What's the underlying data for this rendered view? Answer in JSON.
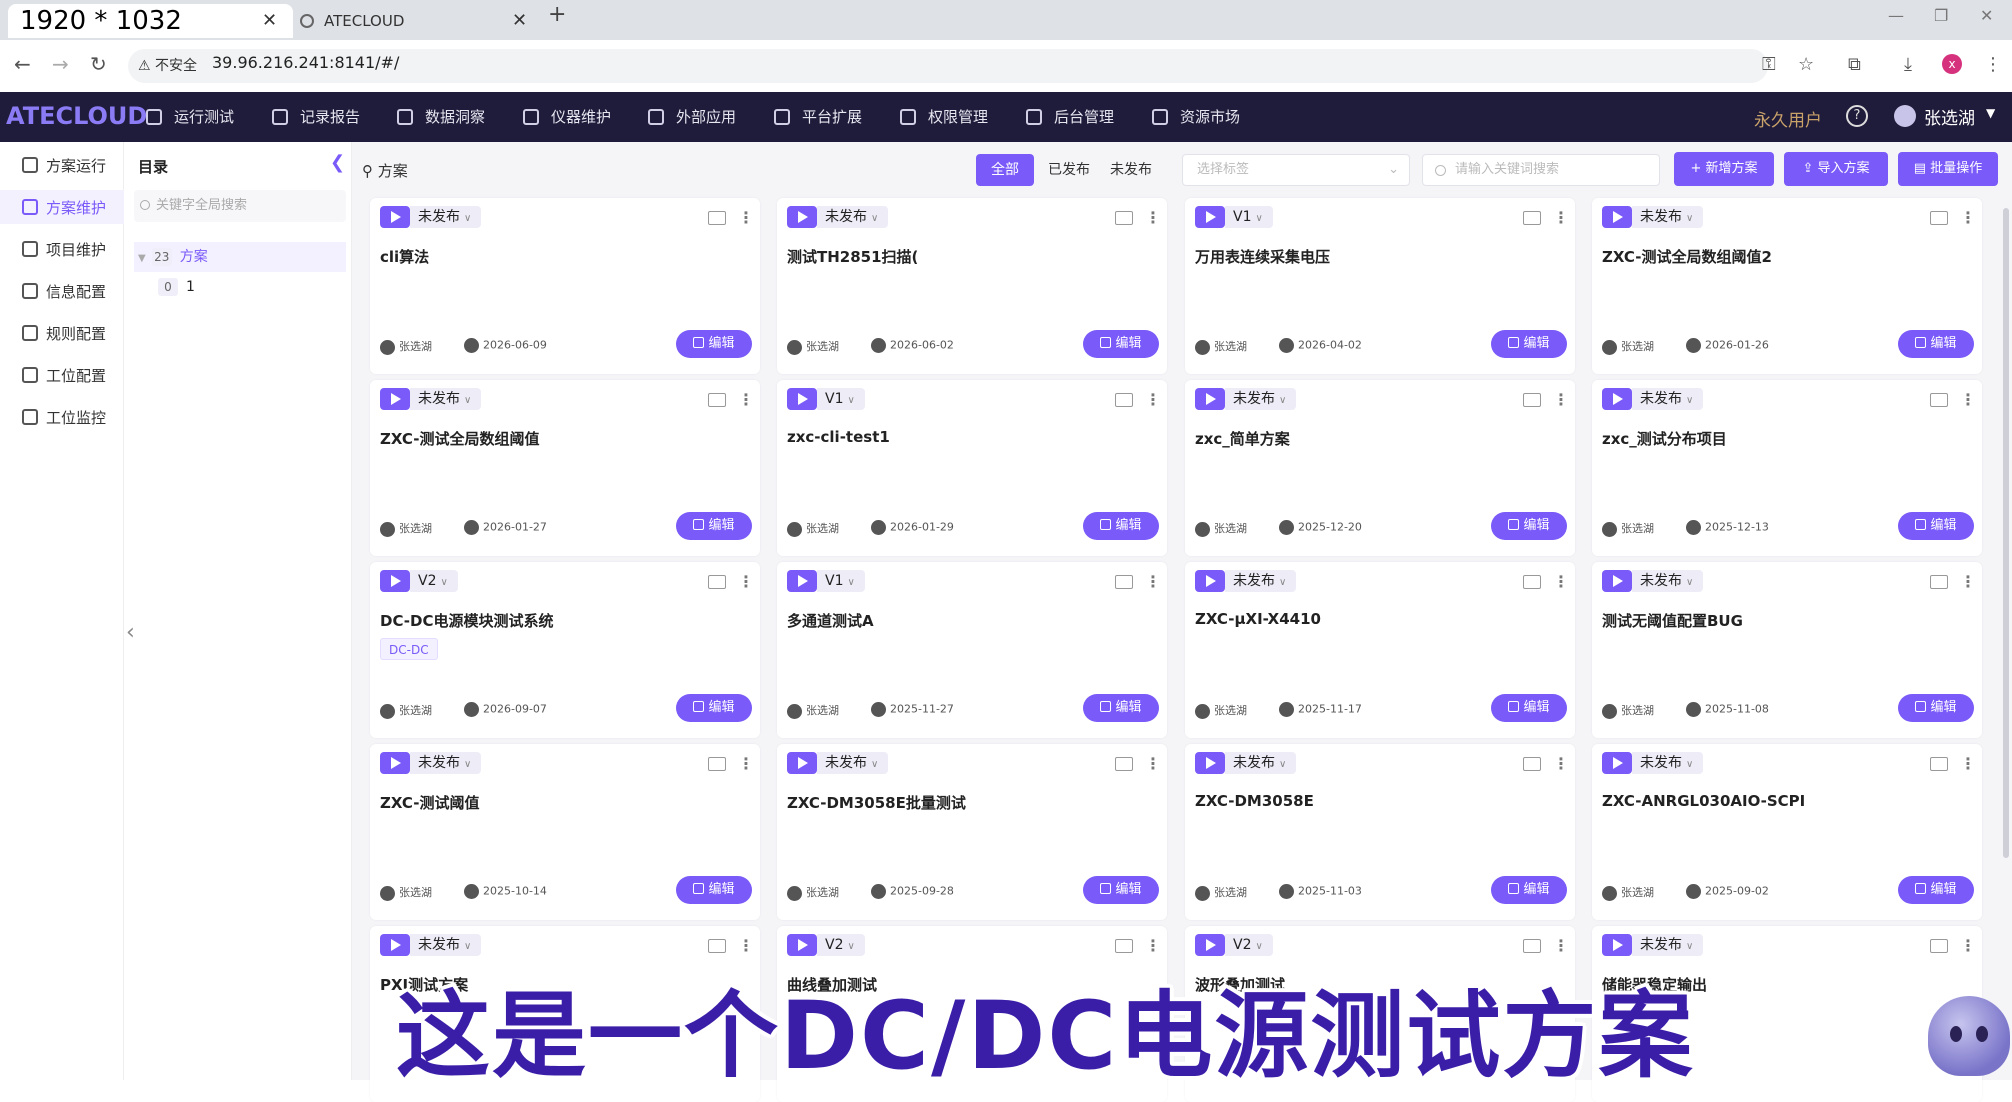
{
  "overlay_label": "1920 * 1032",
  "browser": {
    "tab_title": "ATECLOUD",
    "security_label": "不安全",
    "url": "39.96.216.241:8141/#/"
  },
  "header": {
    "logo": "ATECLOUD",
    "menu": [
      "运行测试",
      "记录报告",
      "数据洞察",
      "仪器维护",
      "外部应用",
      "平台扩展",
      "权限管理",
      "后台管理",
      "资源市场"
    ],
    "vip_label": "永久用户",
    "help_glyph": "?",
    "user_name": "张选湖"
  },
  "sidebar": {
    "items": [
      "方案运行",
      "方案维护",
      "项目维护",
      "信息配置",
      "规则配置",
      "工位配置",
      "工位监控"
    ],
    "active_index": 1
  },
  "tree": {
    "title": "目录",
    "search_placeholder": "关键字全局搜索",
    "nodes": [
      {
        "count": "23",
        "label": "方案"
      },
      {
        "count": "0",
        "label": "1"
      }
    ]
  },
  "main": {
    "breadcrumb": "方案",
    "filters": [
      "全部",
      "已发布",
      "未发布"
    ],
    "active_filter": "全部",
    "tag_placeholder": "选择标签",
    "search_placeholder": "请输入关键词搜索",
    "buttons": [
      "+ 新增方案",
      "导入方案",
      "批量操作"
    ],
    "edit_label": "编辑"
  },
  "cards": [
    {
      "version": "未发布",
      "title": "cli算法",
      "tag": "",
      "user": "张选湖",
      "date": "2026-06-09"
    },
    {
      "version": "未发布",
      "title": "测试TH2851扫描(",
      "tag": "",
      "user": "张选湖",
      "date": "2026-06-02"
    },
    {
      "version": "V1",
      "title": "万用表连续采集电压",
      "tag": "",
      "user": "张选湖",
      "date": "2026-04-02"
    },
    {
      "version": "未发布",
      "title": "ZXC-测试全局数组阈值2",
      "tag": "",
      "user": "张选湖",
      "date": "2026-01-26"
    },
    {
      "version": "未发布",
      "title": "ZXC-测试全局数组阈值",
      "tag": "",
      "user": "张选湖",
      "date": "2026-01-27"
    },
    {
      "version": "V1",
      "title": "zxc-cli-test1",
      "tag": "",
      "user": "张选湖",
      "date": "2026-01-29"
    },
    {
      "version": "未发布",
      "title": "zxc_简单方案",
      "tag": "",
      "user": "张选湖",
      "date": "2025-12-20"
    },
    {
      "version": "未发布",
      "title": "zxc_测试分布项目",
      "tag": "",
      "user": "张选湖",
      "date": "2025-12-13"
    },
    {
      "version": "V2",
      "title": "DC-DC电源模块测试系统",
      "tag": "DC-DC",
      "user": "张选湖",
      "date": "2026-09-07"
    },
    {
      "version": "V1",
      "title": "多通道测试A",
      "tag": "",
      "user": "张选湖",
      "date": "2025-11-27"
    },
    {
      "version": "未发布",
      "title": "ZXC-μXI-X4410",
      "tag": "",
      "user": "张选湖",
      "date": "2025-11-17"
    },
    {
      "version": "未发布",
      "title": "测试无阈值配置BUG",
      "tag": "",
      "user": "张选湖",
      "date": "2025-11-08"
    },
    {
      "version": "未发布",
      "title": "ZXC-测试阈值",
      "tag": "",
      "user": "张选湖",
      "date": "2025-10-14"
    },
    {
      "version": "未发布",
      "title": "ZXC-DM3058E批量测试",
      "tag": "",
      "user": "张选湖",
      "date": "2025-09-28"
    },
    {
      "version": "未发布",
      "title": "ZXC-DM3058E",
      "tag": "",
      "user": "张选湖",
      "date": "2025-11-03"
    },
    {
      "version": "未发布",
      "title": "ZXC-ANRGL030AIO-SCPI",
      "tag": "",
      "user": "张选湖",
      "date": "2025-09-02"
    },
    {
      "version": "未发布",
      "title": "PXI测试方案",
      "tag": "",
      "user": "",
      "date": ""
    },
    {
      "version": "V2",
      "title": "曲线叠加测试",
      "tag": "",
      "user": "",
      "date": ""
    },
    {
      "version": "V2",
      "title": "波形叠加测试",
      "tag": "",
      "user": "",
      "date": ""
    },
    {
      "version": "未发布",
      "title": "储能器稳定输出",
      "tag": "",
      "user": "",
      "date": ""
    }
  ],
  "subtitle": "这是一个DC/DC电源测试方案",
  "colors": {
    "accent": "#7a5af8",
    "header_bg": "#1f1b3a",
    "vip": "#c9a26a"
  }
}
